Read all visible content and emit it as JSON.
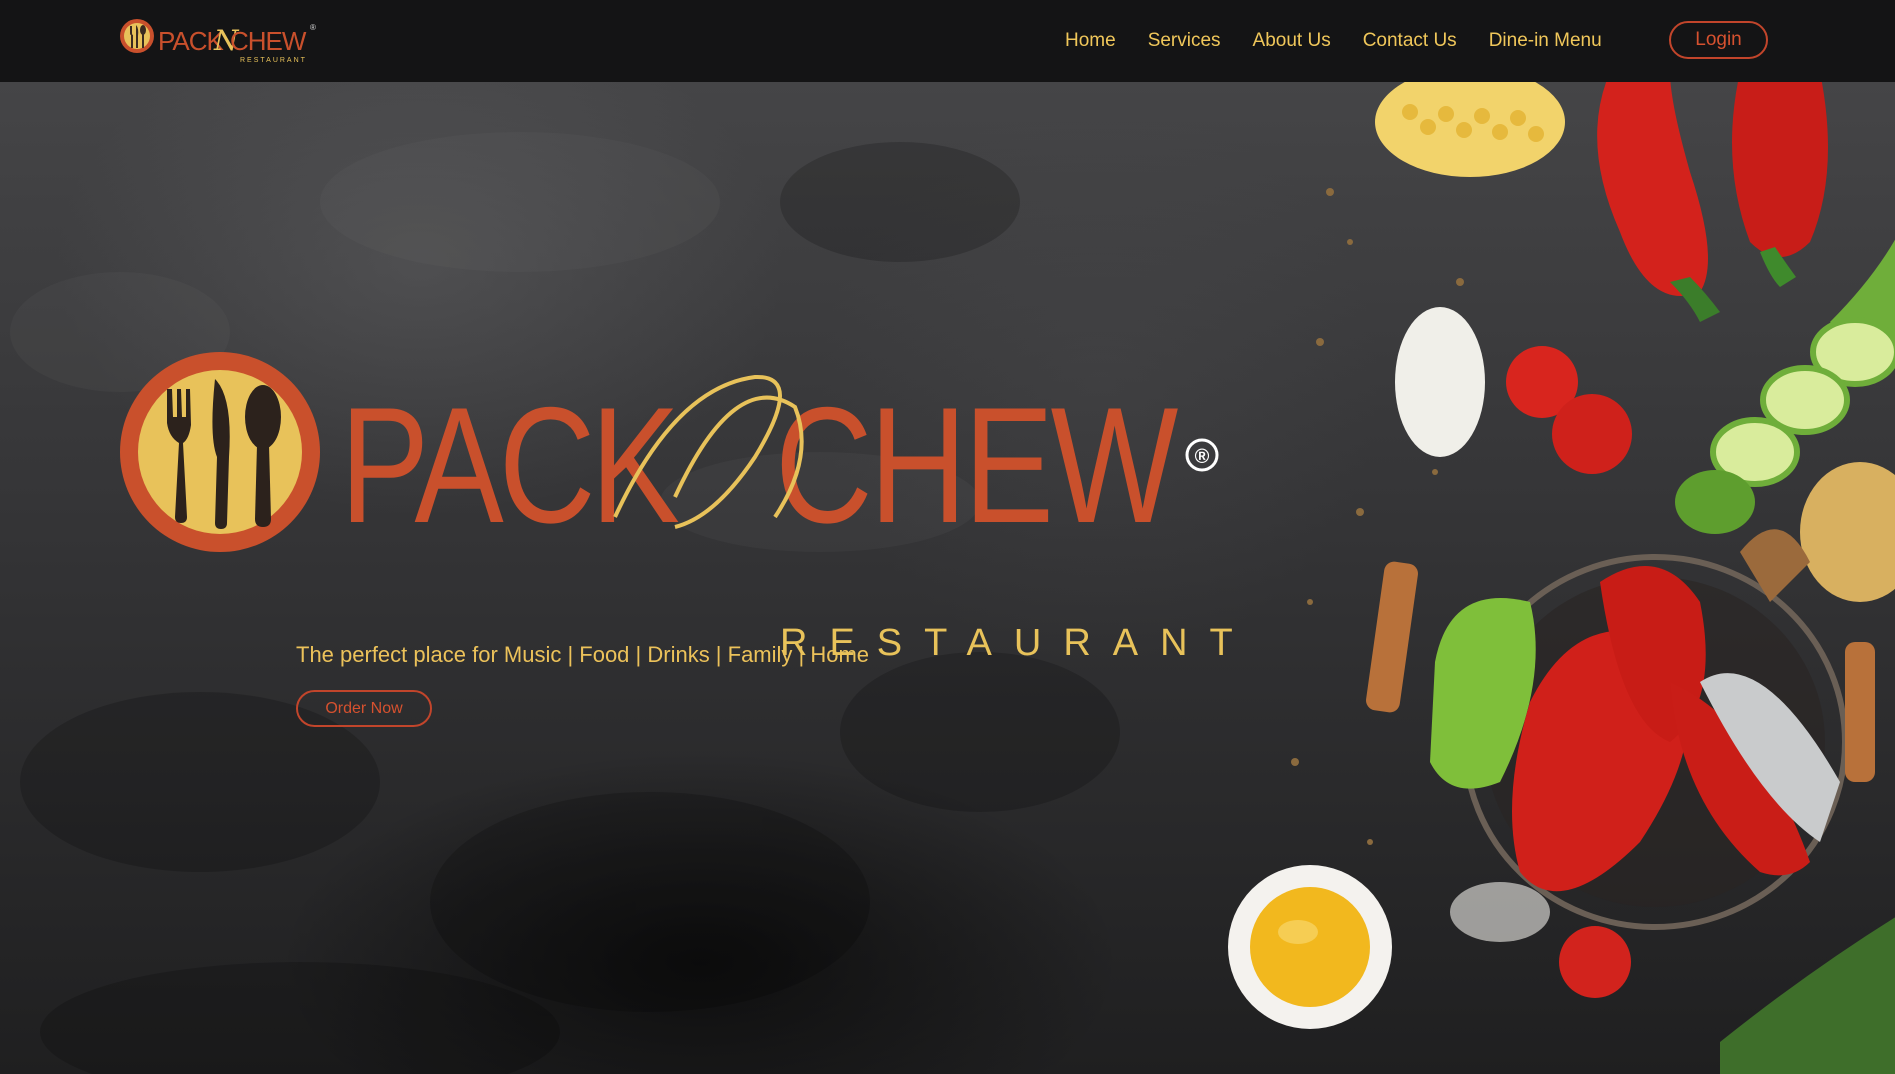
{
  "brand": {
    "name_pack": "PACK",
    "name_n": "N",
    "name_chew": "CHEW",
    "subtitle": "RESTAURANT",
    "registered": "®"
  },
  "nav": {
    "items": [
      {
        "label": "Home"
      },
      {
        "label": "Services"
      },
      {
        "label": "About Us"
      },
      {
        "label": "Contact Us"
      },
      {
        "label": "Dine-in Menu"
      }
    ],
    "login_label": "Login"
  },
  "hero": {
    "tagline": "The perfect place for Music | Food | Drinks | Family | Home",
    "cta_label": "Order Now"
  },
  "colors": {
    "brand_orange": "#c9502c",
    "brand_yellow": "#e8c25a",
    "nav_bg": "#141415",
    "nav_text": "#f0c75a"
  },
  "icons": {
    "logo_mark": "fork-knife-spoon-icon",
    "hero_image": "vegetables-food-photo"
  }
}
